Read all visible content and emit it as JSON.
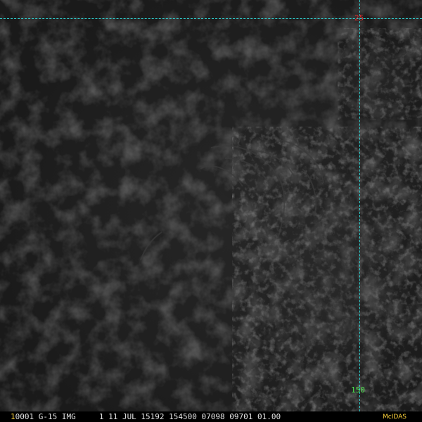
{
  "imagery": {
    "satellite": "G-15",
    "product": "IMG",
    "background": "#1b1b1b"
  },
  "grid": {
    "color": "#2fd3d3",
    "latitude_label": "25",
    "latitude_label_color": "#e03030",
    "longitude_label": "150",
    "longitude_label_color": "#4be34b"
  },
  "status": {
    "frame_number": "1",
    "frame_number_color": "#ffd43b",
    "line": " 0001 G-15 IMG     1 11 JUL 15192 154500 07098 09701 01.00",
    "logo": "McIDAS",
    "logo_color": "#ffd43b",
    "text_color": "#e4e4e4"
  }
}
